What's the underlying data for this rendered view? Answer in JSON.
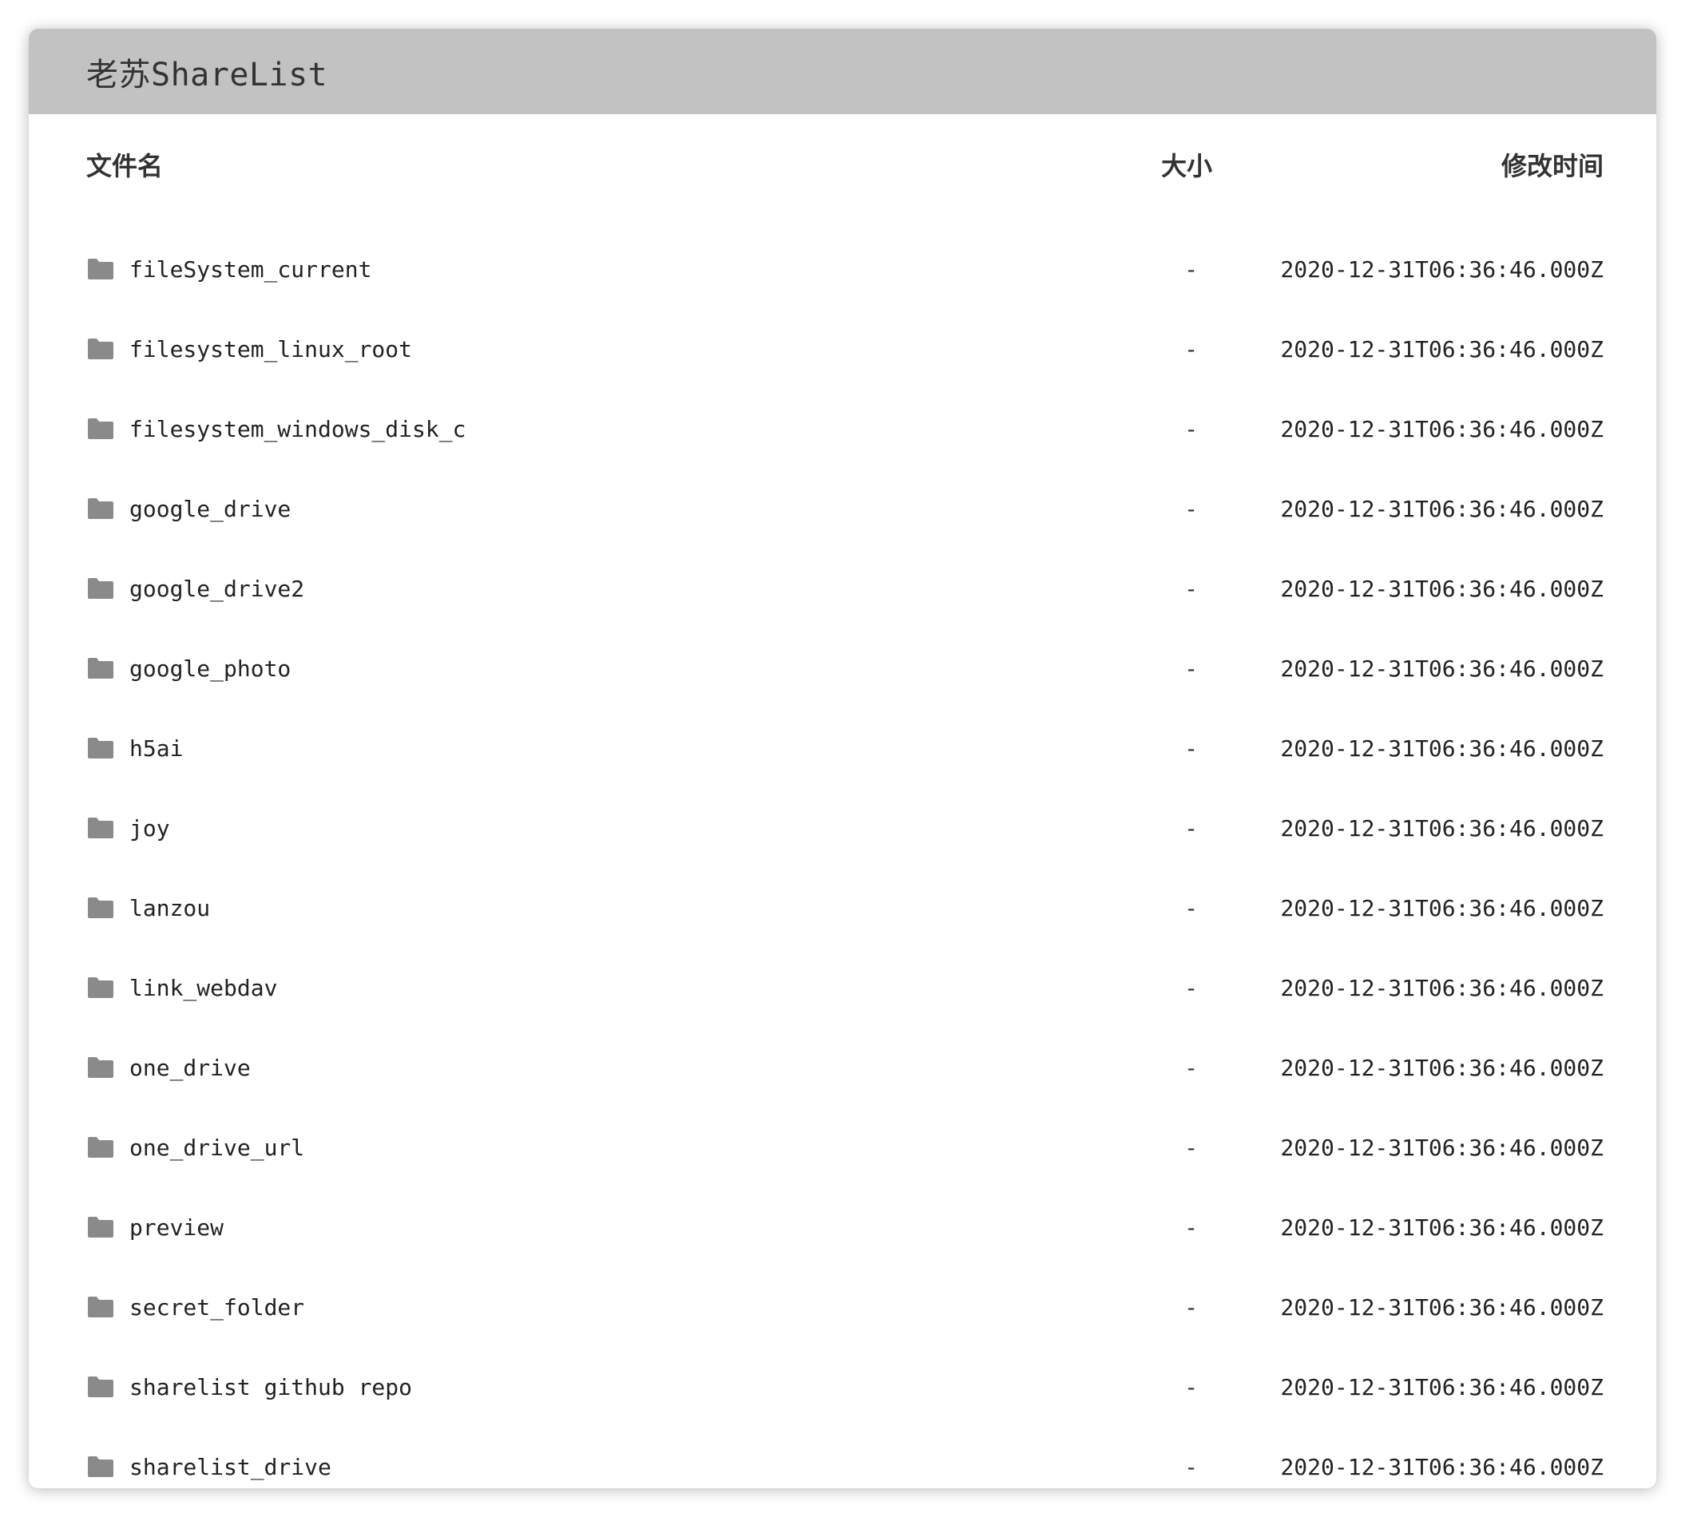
{
  "header": {
    "title": "老苏ShareList"
  },
  "columns": {
    "name": "文件名",
    "size": "大小",
    "modified": "修改时间"
  },
  "colors": {
    "header_bg": "#c2c2c2",
    "folder_icon": "#8a8a8a"
  },
  "rows": [
    {
      "icon": "folder-icon",
      "name": "fileSystem_current",
      "size": "-",
      "modified": "2020-12-31T06:36:46.000Z"
    },
    {
      "icon": "folder-icon",
      "name": "filesystem_linux_root",
      "size": "-",
      "modified": "2020-12-31T06:36:46.000Z"
    },
    {
      "icon": "folder-icon",
      "name": "filesystem_windows_disk_c",
      "size": "-",
      "modified": "2020-12-31T06:36:46.000Z"
    },
    {
      "icon": "folder-icon",
      "name": "google_drive",
      "size": "-",
      "modified": "2020-12-31T06:36:46.000Z"
    },
    {
      "icon": "folder-icon",
      "name": "google_drive2",
      "size": "-",
      "modified": "2020-12-31T06:36:46.000Z"
    },
    {
      "icon": "folder-icon",
      "name": "google_photo",
      "size": "-",
      "modified": "2020-12-31T06:36:46.000Z"
    },
    {
      "icon": "folder-icon",
      "name": "h5ai",
      "size": "-",
      "modified": "2020-12-31T06:36:46.000Z"
    },
    {
      "icon": "folder-icon",
      "name": "joy",
      "size": "-",
      "modified": "2020-12-31T06:36:46.000Z"
    },
    {
      "icon": "folder-icon",
      "name": "lanzou",
      "size": "-",
      "modified": "2020-12-31T06:36:46.000Z"
    },
    {
      "icon": "folder-icon",
      "name": "link_webdav",
      "size": "-",
      "modified": "2020-12-31T06:36:46.000Z"
    },
    {
      "icon": "folder-icon",
      "name": "one_drive",
      "size": "-",
      "modified": "2020-12-31T06:36:46.000Z"
    },
    {
      "icon": "folder-icon",
      "name": "one_drive_url",
      "size": "-",
      "modified": "2020-12-31T06:36:46.000Z"
    },
    {
      "icon": "folder-icon",
      "name": "preview",
      "size": "-",
      "modified": "2020-12-31T06:36:46.000Z"
    },
    {
      "icon": "folder-icon",
      "name": "secret_folder",
      "size": "-",
      "modified": "2020-12-31T06:36:46.000Z"
    },
    {
      "icon": "folder-icon",
      "name": "sharelist github repo",
      "size": "-",
      "modified": "2020-12-31T06:36:46.000Z"
    },
    {
      "icon": "folder-icon",
      "name": "sharelist_drive",
      "size": "-",
      "modified": "2020-12-31T06:36:46.000Z"
    }
  ]
}
